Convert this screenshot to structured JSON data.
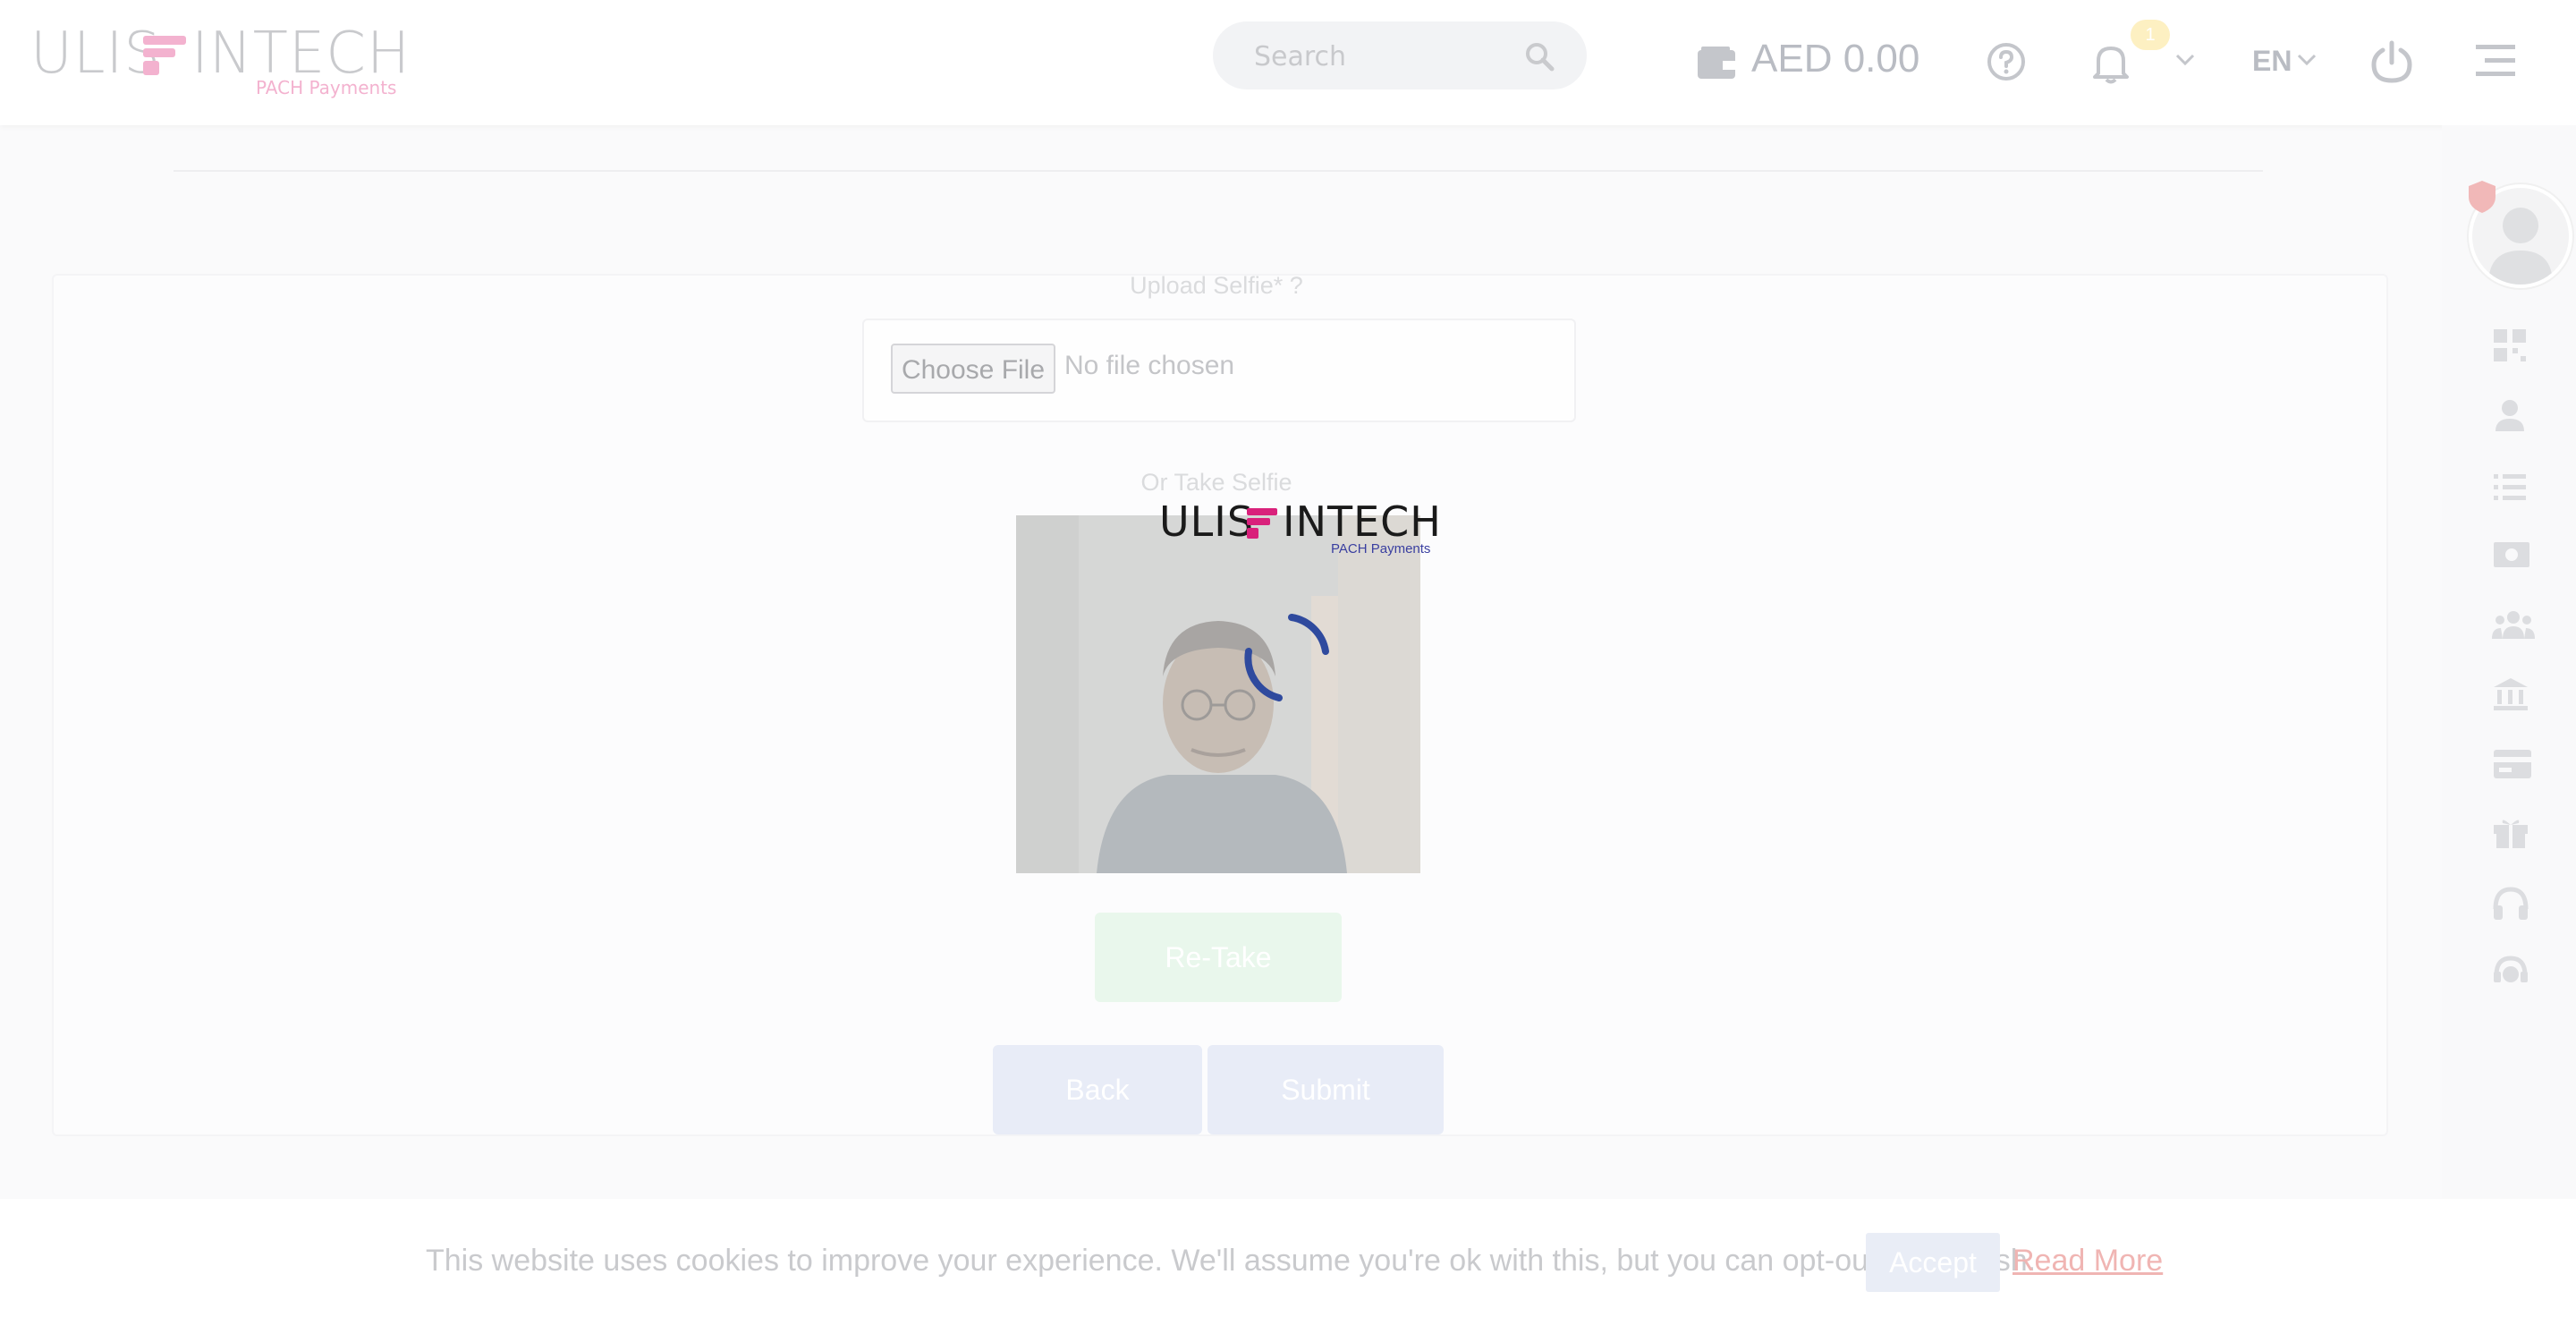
{
  "header": {
    "logo": {
      "left": "ULIS",
      "right": "INTECH",
      "sub": "PACH Payments"
    },
    "search": {
      "placeholder": "Search"
    },
    "balance": "AED 0.00",
    "notifications_count": "1",
    "language": "EN"
  },
  "sidebar": {
    "icons": [
      "dashboard-icon",
      "user-icon",
      "list-icon",
      "money-icon",
      "group-icon",
      "bank-icon",
      "card-icon",
      "gift-icon",
      "headphones-icon",
      "support-agent-icon"
    ]
  },
  "form": {
    "upload_label": "Upload Selfie* ?",
    "choose_file": "Choose File",
    "no_file": "No file chosen",
    "take_label": "Or Take Selfie",
    "retake": "Re-Take",
    "back": "Back",
    "submit": "Submit"
  },
  "loader": {
    "logo": {
      "left": "ULIS",
      "right": "INTECH",
      "sub": "PACH Payments"
    }
  },
  "cookie": {
    "text": "This website uses cookies to improve your experience. We'll assume you're ok with this, but you can opt-out if you wish.",
    "accept": "Accept",
    "read_more": "Read More"
  },
  "colors": {
    "brand_pink": "#d9217b",
    "spinner_blue": "#2f4a9e",
    "retake_green": "#e9f7ec",
    "primary_faded": "#e8ecf7"
  }
}
